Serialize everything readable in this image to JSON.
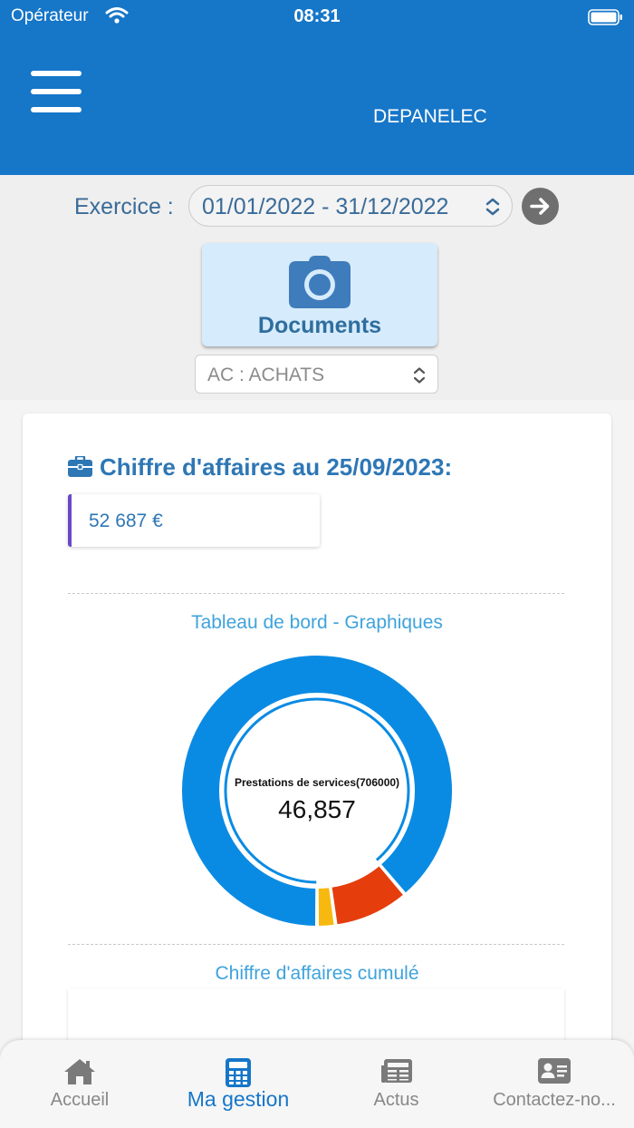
{
  "status_bar": {
    "carrier": "Opérateur",
    "time": "08:31"
  },
  "header": {
    "title": "DEPANELEC"
  },
  "exercise": {
    "label": "Exercice :",
    "value": "01/01/2022 - 31/12/2022"
  },
  "documents_button": {
    "label": "Documents"
  },
  "journal_select": {
    "value": "AC : ACHATS"
  },
  "revenue": {
    "title": "Chiffre d'affaires au 25/09/2023:",
    "value": "52 687 €"
  },
  "dashboard": {
    "title": "Tableau de bord - Graphiques",
    "cumulative_title": "Chiffre d'affaires cumulé"
  },
  "chart_data": {
    "type": "pie",
    "variant": "donut",
    "center_label": "Prestations de services(706000)",
    "center_value": "46,857",
    "slices": [
      {
        "name": "Prestations de services(706000)",
        "fraction": 0.888,
        "color": "#0a8be3",
        "highlighted": true
      },
      {
        "name": "",
        "fraction": 0.09,
        "color": "#e63d0d"
      },
      {
        "name": "",
        "fraction": 0.022,
        "color": "#f7b90f"
      }
    ]
  },
  "tabbar": {
    "tabs": [
      {
        "label": "Accueil",
        "icon": "home-icon",
        "active": false
      },
      {
        "label": "Ma gestion",
        "icon": "calculator-icon",
        "active": true
      },
      {
        "label": "Actus",
        "icon": "newspaper-icon",
        "active": false
      },
      {
        "label": "Contactez-no...",
        "icon": "contact-card-icon",
        "active": false
      }
    ]
  }
}
